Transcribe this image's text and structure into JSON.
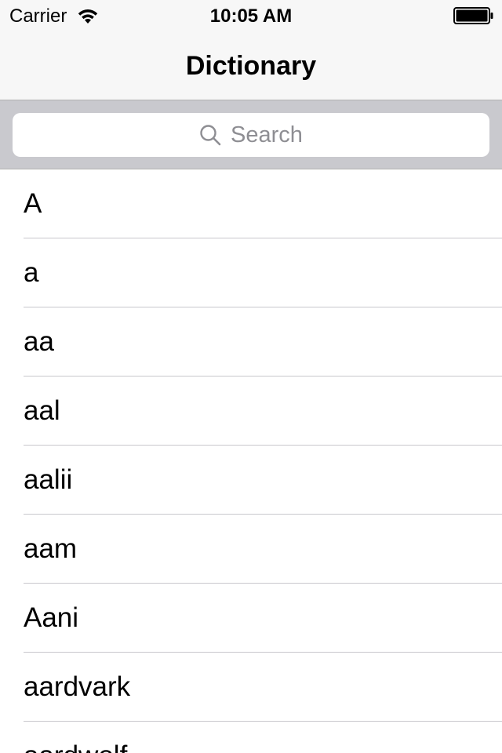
{
  "status_bar": {
    "carrier": "Carrier",
    "time": "10:05 AM",
    "wifi_icon": "wifi-icon",
    "battery_icon": "battery-full-icon"
  },
  "nav_bar": {
    "title": "Dictionary"
  },
  "search": {
    "placeholder": "Search",
    "icon": "search-icon"
  },
  "words": [
    "A",
    "a",
    "aa",
    "aal",
    "aalii",
    "aam",
    "Aani",
    "aardvark",
    "aardwolf"
  ],
  "colors": {
    "bar_background": "#f7f7f7",
    "search_bar_background": "#c9c9ce",
    "placeholder": "#8e8e93",
    "separator": "#c8c7cc"
  }
}
